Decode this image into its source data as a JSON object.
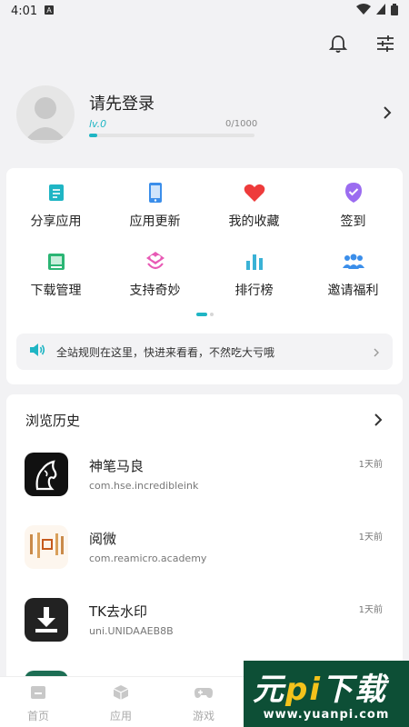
{
  "status_bar": {
    "time": "4:01"
  },
  "profile": {
    "login_prompt": "请先登录",
    "level": "lv.0",
    "experience": "0/1000",
    "progress_fraction": 0.05
  },
  "quick_actions": [
    {
      "label": "分享应用",
      "icon": "share-doc-icon",
      "color": "#1fb5c4"
    },
    {
      "label": "应用更新",
      "icon": "phone-update-icon",
      "color": "#3b8eea"
    },
    {
      "label": "我的收藏",
      "icon": "heart-icon",
      "color": "#ee3b3b"
    },
    {
      "label": "签到",
      "icon": "checkin-badge-icon",
      "color": "#9b6cf0"
    },
    {
      "label": "下载管理",
      "icon": "download-tray-icon",
      "color": "#2bb574"
    },
    {
      "label": "支持奇妙",
      "icon": "support-heart-icon",
      "color": "#e85ab5"
    },
    {
      "label": "排行榜",
      "icon": "bar-chart-icon",
      "color": "#3ab2d6"
    },
    {
      "label": "邀请福利",
      "icon": "invite-users-icon",
      "color": "#3b8eea"
    }
  ],
  "notice": {
    "text": "全站规则在这里，快进来看看，不然吃大亏哦"
  },
  "history": {
    "title": "浏览历史",
    "items": [
      {
        "name": "神笔马良",
        "package": "com.hse.incredibleink",
        "time": "1天前"
      },
      {
        "name": "阅微",
        "package": "com.reamicro.academy",
        "time": "1天前"
      },
      {
        "name": "TK去水印",
        "package": "uni.UNIDAAEB8B",
        "time": "1天前"
      }
    ]
  },
  "bottom_nav": [
    {
      "label": "首页",
      "icon": "home-icon"
    },
    {
      "label": "应用",
      "icon": "cube-icon"
    },
    {
      "label": "游戏",
      "icon": "gamepad-icon"
    }
  ],
  "watermark": {
    "title_part1": "元",
    "title_part2": "pi",
    "title_part3": "下载",
    "url": "www.yuanpi.com"
  }
}
